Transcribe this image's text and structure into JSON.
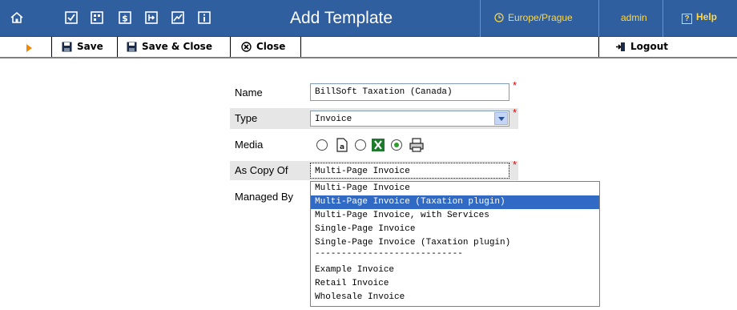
{
  "header": {
    "title": "Add Template",
    "timezone": "Europe/Prague",
    "user": "admin",
    "help": "Help",
    "help_icon_glyph": "?",
    "icons": [
      "home-icon",
      "checkbox-icon",
      "grid-icon",
      "dollar-icon",
      "export-icon",
      "chart-icon",
      "info-icon"
    ]
  },
  "toolbar": {
    "save_label": "Save",
    "save_close_label": "Save & Close",
    "close_label": "Close",
    "logout_label": "Logout"
  },
  "form": {
    "name_label": "Name",
    "name_value": "BillSoft Taxation (Canada)",
    "type_label": "Type",
    "type_value": "Invoice",
    "media_label": "Media",
    "media_options": [
      "pdf",
      "excel",
      "print"
    ],
    "media_selected": "print",
    "as_copy_of_label": "As Copy Of",
    "as_copy_of_value": "Multi-Page Invoice",
    "managed_by_label": "Managed By",
    "required_mark": "*"
  },
  "dropdown": {
    "options": [
      "Multi-Page Invoice",
      "Multi-Page Invoice (Taxation plugin)",
      "Multi-Page Invoice, with Services",
      "Single-Page Invoice",
      "Single-Page Invoice (Taxation plugin)",
      "----------------------------",
      "",
      "Example Invoice",
      "Retail Invoice",
      "Wholesale Invoice"
    ],
    "highlighted": "Multi-Page Invoice (Taxation plugin)"
  },
  "colors": {
    "header_bg": "#2f5f9f",
    "accent_yellow": "#ffd84a",
    "selection": "#316ac5",
    "required": "#e00000"
  }
}
